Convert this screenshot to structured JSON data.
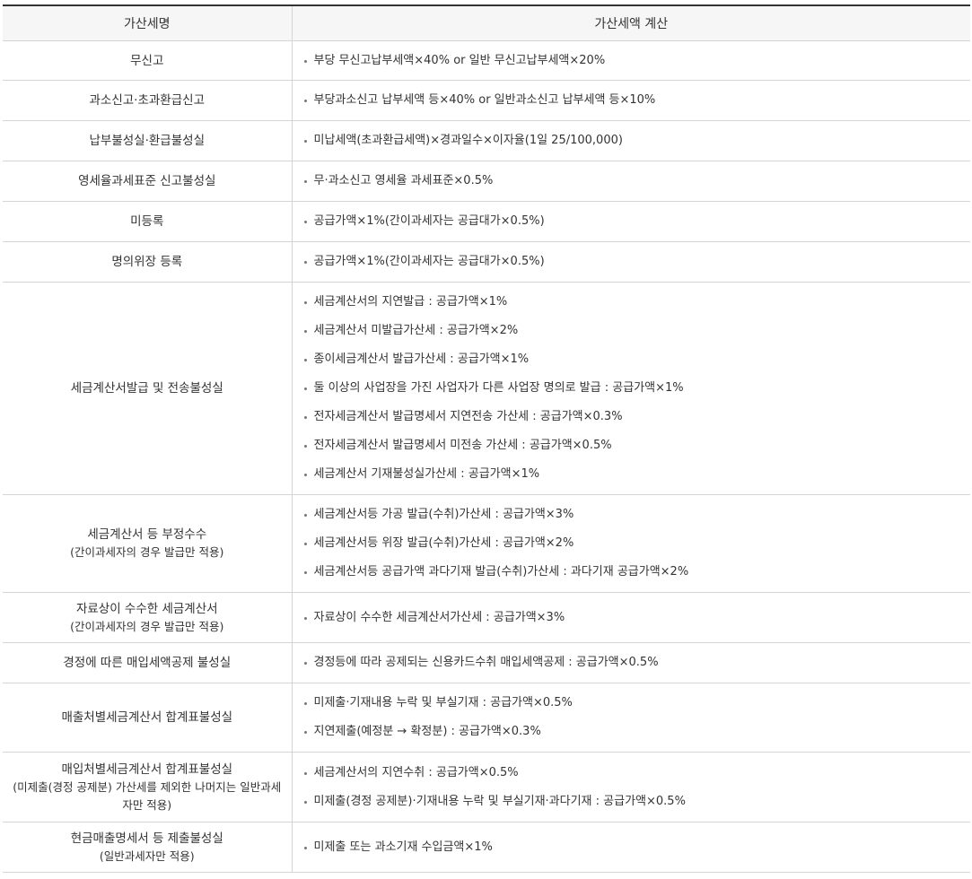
{
  "header": {
    "col_name": "가산세명",
    "col_calc": "가산세액 계산"
  },
  "rows": [
    {
      "name": "무신고",
      "sub": "",
      "items": [
        "부당 무신고납부세액×40% or 일반 무신고납부세액×20%"
      ]
    },
    {
      "name": "과소신고·초과환급신고",
      "sub": "",
      "items": [
        "부당과소신고 납부세액 등×40% or 일반과소신고 납부세액 등×10%"
      ]
    },
    {
      "name": "납부불성실·환급불성실",
      "sub": "",
      "items": [
        "미납세액(초과환급세액)×경과일수×이자율(1일 25/100,000)"
      ]
    },
    {
      "name": "영세율과세표준 신고불성실",
      "sub": "",
      "items": [
        "무·과소신고 영세율 과세표준×0.5%"
      ]
    },
    {
      "name": "미등록",
      "sub": "",
      "items": [
        "공급가액×1%(간이과세자는 공급대가×0.5%)"
      ]
    },
    {
      "name": "명의위장 등록",
      "sub": "",
      "items": [
        "공급가액×1%(간이과세자는 공급대가×0.5%)"
      ]
    },
    {
      "name": "세금계산서발급 및 전송불성실",
      "sub": "",
      "items": [
        "세금계산서의 지연발급 : 공급가액×1%",
        "세금계산서 미발급가산세 : 공급가액×2%",
        "종이세금계산서 발급가산세 : 공급가액×1%",
        "둘 이상의 사업장을 가진 사업자가 다른 사업장 명의로 발급 : 공급가액×1%",
        "전자세금계산서 발급명세서 지연전송 가산세 : 공급가액×0.3%",
        "전자세금계산서 발급명세서 미전송 가산세 : 공급가액×0.5%",
        "세금계산서 기재불성실가산세 : 공급가액×1%"
      ]
    },
    {
      "name": "세금계산서 등 부정수수",
      "sub": "(간이과세자의 경우 발급만 적용)",
      "items": [
        "세금계산서등 가공 발급(수취)가산세 : 공급가액×3%",
        "세금계산서등 위장 발급(수취)가산세 : 공급가액×2%",
        "세금계산서등 공급가액 과다기재 발급(수취)가산세 : 과다기재 공급가액×2%"
      ]
    },
    {
      "name": "자료상이 수수한 세금계산서",
      "sub": "(간이과세자의 경우 발급만 적용)",
      "items": [
        "자료상이 수수한 세금계산서가산세 : 공급가액×3%"
      ]
    },
    {
      "name": "경정에 따른 매입세액공제 불성실",
      "sub": "",
      "items": [
        "경정등에 따라 공제되는 신용카드수취 매입세액공제 : 공급가액×0.5%"
      ]
    },
    {
      "name": "매출처별세금계산서 합계표불성실",
      "sub": "",
      "items": [
        "미제출·기재내용 누락 및 부실기재 : 공급가액×0.5%",
        "지연제출(예정분 → 확정분) : 공급가액×0.3%"
      ]
    },
    {
      "name": "매입처별세금계산서 합계표불성실",
      "sub": "(미제출(경정 공제분) 가산세를 제외한 나머지는 일반과세자만 적용)",
      "items": [
        "세금계산서의 지연수취 : 공급가액×0.5%",
        "미제출(경정 공제분)·기재내용 누락 및 부실기재·과다기재 : 공급가액×0.5%"
      ]
    },
    {
      "name": "현금매출명세서 등 제출불성실",
      "sub": "(일반과세자만 적용)",
      "items": [
        "미제출 또는 과소기재 수입금액×1%"
      ]
    }
  ]
}
